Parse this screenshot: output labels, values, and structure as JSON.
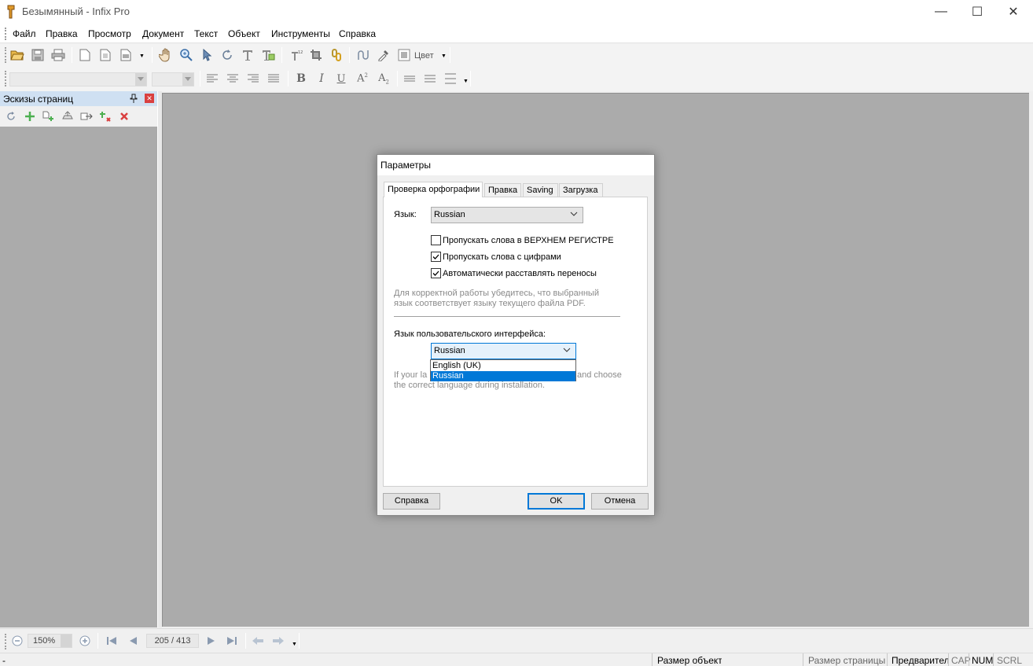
{
  "window": {
    "title": "Безымянный - Infix Pro",
    "minimize": "—",
    "maximize": "☐",
    "close": "✕"
  },
  "menu": [
    "Файл",
    "Правка",
    "Просмотр",
    "Документ",
    "Текст",
    "Объект",
    "Инструменты",
    "Справка"
  ],
  "toolbar": {
    "color_label": "Цвет"
  },
  "side_panel": {
    "title": "Эскизы страниц"
  },
  "navigation": {
    "zoom": "150%",
    "page": "205 / 413"
  },
  "status_bar": {
    "left": "-",
    "object_size": "Размер объект",
    "page_size": "Размер страницы",
    "preview": "Предварител",
    "cap": "CAP",
    "num": "NUM",
    "scrl": "SCRL"
  },
  "dialog": {
    "title": "Параметры",
    "tabs": [
      "Проверка орфографии",
      "Правка",
      "Saving",
      "Загрузка"
    ],
    "language_label": "Язык:",
    "language_value": "Russian",
    "checkboxes": [
      {
        "label": "Пропускать слова в ВЕРХНЕМ РЕГИСТРЕ",
        "checked": false
      },
      {
        "label": "Пропускать слова с цифрами",
        "checked": true
      },
      {
        "label": "Автоматически расставлять переносы",
        "checked": true
      }
    ],
    "hint_line1": "Для корректной работы убедитесь, что выбранный",
    "hint_line2": "язык соответствует языку текущего файла PDF.",
    "ui_language_label": "Язык пользовательского интерфейса:",
    "ui_language_value": "Russian",
    "ui_language_options": [
      "English (UK)",
      "Russian"
    ],
    "ui_language_selected": "Russian",
    "ui_hint_line1_start": "If your la",
    "ui_hint_line1_end": "and choose",
    "ui_hint_line2": "the correct language during installation.",
    "help_button": "Справка",
    "ok_button": "OK",
    "cancel_button": "Отмена"
  },
  "colors": {
    "accent": "#0078d7",
    "workspace": "#ababab",
    "panel_header": "#cfe0f2"
  }
}
